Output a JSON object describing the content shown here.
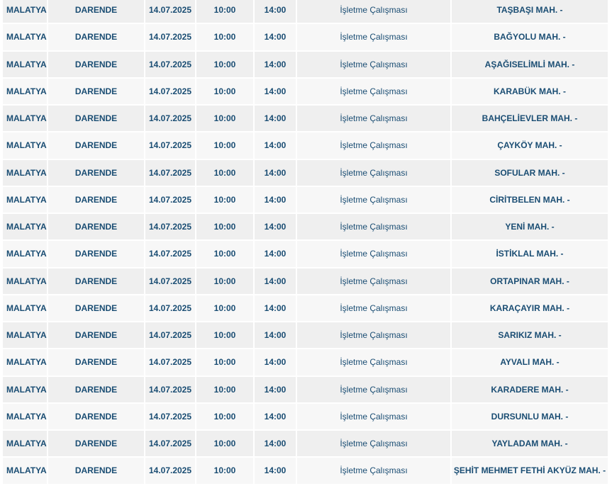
{
  "table": {
    "rows": [
      {
        "il": "MALATYA",
        "ilce": "DARENDE",
        "tarih": "14.07.2025",
        "baslangic": "10:00",
        "bitis": "14:00",
        "neden": "İşletme Çalışması",
        "mahalle": "TAŞBAŞI MAH. -"
      },
      {
        "il": "MALATYA",
        "ilce": "DARENDE",
        "tarih": "14.07.2025",
        "baslangic": "10:00",
        "bitis": "14:00",
        "neden": "İşletme Çalışması",
        "mahalle": "BAĞYOLU MAH. -"
      },
      {
        "il": "MALATYA",
        "ilce": "DARENDE",
        "tarih": "14.07.2025",
        "baslangic": "10:00",
        "bitis": "14:00",
        "neden": "İşletme Çalışması",
        "mahalle": "AŞAĞISELİMLİ MAH. -"
      },
      {
        "il": "MALATYA",
        "ilce": "DARENDE",
        "tarih": "14.07.2025",
        "baslangic": "10:00",
        "bitis": "14:00",
        "neden": "İşletme Çalışması",
        "mahalle": "KARABÜK MAH. -"
      },
      {
        "il": "MALATYA",
        "ilce": "DARENDE",
        "tarih": "14.07.2025",
        "baslangic": "10:00",
        "bitis": "14:00",
        "neden": "İşletme Çalışması",
        "mahalle": "BAHÇELİEVLER MAH. -"
      },
      {
        "il": "MALATYA",
        "ilce": "DARENDE",
        "tarih": "14.07.2025",
        "baslangic": "10:00",
        "bitis": "14:00",
        "neden": "İşletme Çalışması",
        "mahalle": "ÇAYKÖY MAH. -"
      },
      {
        "il": "MALATYA",
        "ilce": "DARENDE",
        "tarih": "14.07.2025",
        "baslangic": "10:00",
        "bitis": "14:00",
        "neden": "İşletme Çalışması",
        "mahalle": "SOFULAR MAH. -"
      },
      {
        "il": "MALATYA",
        "ilce": "DARENDE",
        "tarih": "14.07.2025",
        "baslangic": "10:00",
        "bitis": "14:00",
        "neden": "İşletme Çalışması",
        "mahalle": "CİRİTBELEN MAH. -"
      },
      {
        "il": "MALATYA",
        "ilce": "DARENDE",
        "tarih": "14.07.2025",
        "baslangic": "10:00",
        "bitis": "14:00",
        "neden": "İşletme Çalışması",
        "mahalle": "YENİ MAH. -"
      },
      {
        "il": "MALATYA",
        "ilce": "DARENDE",
        "tarih": "14.07.2025",
        "baslangic": "10:00",
        "bitis": "14:00",
        "neden": "İşletme Çalışması",
        "mahalle": "İSTİKLAL MAH. -"
      },
      {
        "il": "MALATYA",
        "ilce": "DARENDE",
        "tarih": "14.07.2025",
        "baslangic": "10:00",
        "bitis": "14:00",
        "neden": "İşletme Çalışması",
        "mahalle": "ORTAPINAR MAH. -"
      },
      {
        "il": "MALATYA",
        "ilce": "DARENDE",
        "tarih": "14.07.2025",
        "baslangic": "10:00",
        "bitis": "14:00",
        "neden": "İşletme Çalışması",
        "mahalle": "KARAÇAYIR MAH. -"
      },
      {
        "il": "MALATYA",
        "ilce": "DARENDE",
        "tarih": "14.07.2025",
        "baslangic": "10:00",
        "bitis": "14:00",
        "neden": "İşletme Çalışması",
        "mahalle": "SARIKIZ MAH. -"
      },
      {
        "il": "MALATYA",
        "ilce": "DARENDE",
        "tarih": "14.07.2025",
        "baslangic": "10:00",
        "bitis": "14:00",
        "neden": "İşletme Çalışması",
        "mahalle": "AYVALI MAH. -"
      },
      {
        "il": "MALATYA",
        "ilce": "DARENDE",
        "tarih": "14.07.2025",
        "baslangic": "10:00",
        "bitis": "14:00",
        "neden": "İşletme Çalışması",
        "mahalle": "KARADERE MAH. -"
      },
      {
        "il": "MALATYA",
        "ilce": "DARENDE",
        "tarih": "14.07.2025",
        "baslangic": "10:00",
        "bitis": "14:00",
        "neden": "İşletme Çalışması",
        "mahalle": "DURSUNLU MAH. -"
      },
      {
        "il": "MALATYA",
        "ilce": "DARENDE",
        "tarih": "14.07.2025",
        "baslangic": "10:00",
        "bitis": "14:00",
        "neden": "İşletme Çalışması",
        "mahalle": "YAYLADAM MAH. -"
      },
      {
        "il": "MALATYA",
        "ilce": "DARENDE",
        "tarih": "14.07.2025",
        "baslangic": "10:00",
        "bitis": "14:00",
        "neden": "İşletme Çalışması",
        "mahalle": "ŞEHİT MEHMET FETHİ AKYÜZ MAH. -"
      }
    ]
  },
  "colors": {
    "text": "#1a4d73",
    "row_odd": "#efefef",
    "row_even": "#f7f7f7"
  }
}
